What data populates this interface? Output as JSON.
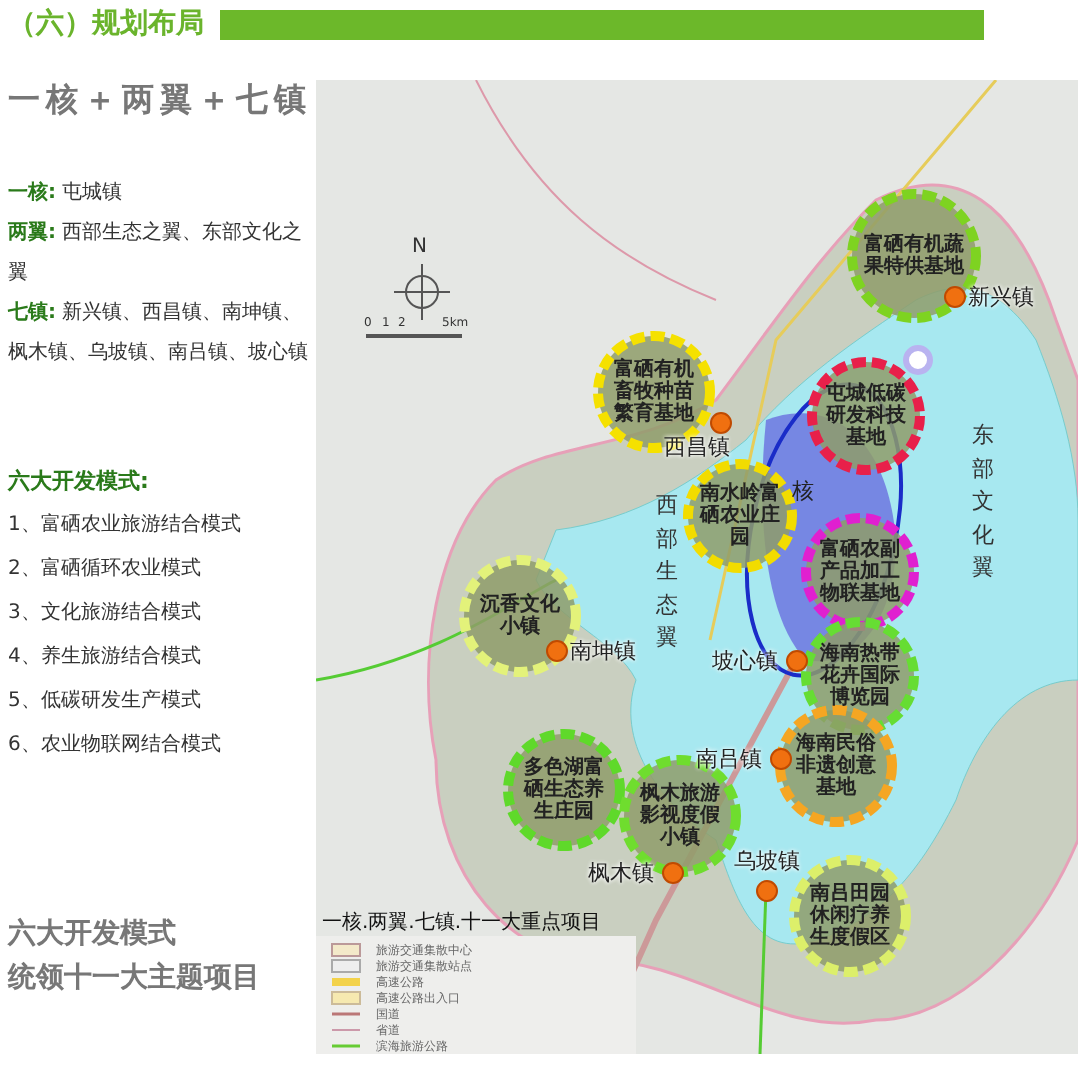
{
  "header": {
    "title": "（六）规划布局"
  },
  "structure": {
    "title": "一核＋两翼＋七镇",
    "items": [
      {
        "label": "一核:",
        "text": "屯城镇"
      },
      {
        "label": "两翼:",
        "text": "西部生态之翼、东部文化之翼"
      },
      {
        "label": "七镇:",
        "text": "新兴镇、西昌镇、南坤镇、枫木镇、乌坡镇、南吕镇、坡心镇"
      }
    ]
  },
  "modes": {
    "title": "六大开发模式:",
    "items": [
      "1、富硒农业旅游结合模式",
      "2、富硒循环农业模式",
      "3、文化旅游结合模式",
      "4、养生旅游结合模式",
      "5、低碳研发生产模式",
      "6、农业物联网结合模式"
    ]
  },
  "slogan": [
    "六大开发模式",
    "统领十一大主题项目"
  ],
  "map": {
    "compass": "N",
    "scale": [
      "0",
      "1",
      "2",
      "5km"
    ],
    "core": "核",
    "wings": [
      "西部生态翼",
      "东部文化翼"
    ],
    "projects": [
      {
        "name": "富硒有机蔬果特供基地",
        "color": "#7ed321"
      },
      {
        "name": "富硒有机畜牧种苗繁育基地",
        "color": "#f5e100"
      },
      {
        "name": "屯城低碳研发科技基地",
        "color": "#e8204a"
      },
      {
        "name": "南水岭富硒农业庄园",
        "color": "#f2dc00"
      },
      {
        "name": "富硒农副产品加工物联基地",
        "color": "#e020d0"
      },
      {
        "name": "沉香文化小镇",
        "color": "#e3f27a"
      },
      {
        "name": "海南热带花卉国际博览园",
        "color": "#66dd33"
      },
      {
        "name": "海南民俗非遗创意基地",
        "color": "#f5a623"
      },
      {
        "name": "多色湖富硒生态养生庄园",
        "color": "#5fd92a"
      },
      {
        "name": "枫木旅游影视度假小镇",
        "color": "#6fdd2e"
      },
      {
        "name": "南吕田园休闲疗养生度假区",
        "color": "#dcef6a"
      }
    ],
    "towns": [
      "新兴镇",
      "西昌镇",
      "南坤镇",
      "坡心镇",
      "南吕镇",
      "枫木镇",
      "乌坡镇"
    ],
    "legend": {
      "title": "一核.两翼.七镇.十一大重点项目",
      "items": [
        {
          "kind": "hub",
          "label": "旅游交通集散中心"
        },
        {
          "kind": "stop",
          "label": "旅游交通集散站点"
        },
        {
          "kind": "expressway",
          "label": "高速公路"
        },
        {
          "kind": "exit",
          "label": "高速公路出入口"
        },
        {
          "kind": "national",
          "label": "国道"
        },
        {
          "kind": "provincial",
          "label": "省道"
        },
        {
          "kind": "greenway",
          "label": "滨海旅游公路"
        }
      ]
    }
  }
}
